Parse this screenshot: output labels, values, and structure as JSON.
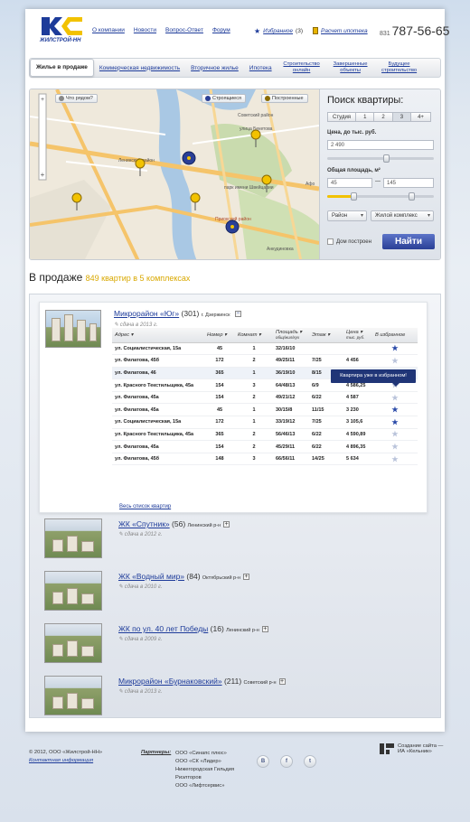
{
  "header": {
    "logo_text": "ЖИЛСТРОЙ-НН",
    "nav": [
      "О компании",
      "Новости",
      "Вопрос-Ответ",
      "Форум"
    ],
    "favorites_label": "Избранное",
    "favorites_count": "(3)",
    "mortgage_label": "Расчет ипотека",
    "phone_code": "831",
    "phone_number": "787-56-65"
  },
  "menu": [
    "Жилье в продаже",
    "Коммерческая недвижимость",
    "Вторичное жилье",
    "Ипотека",
    "Строительство онлайн",
    "Завершенные объекты",
    "Будущее строительство"
  ],
  "map": {
    "btn_where": "Что рядом?",
    "btn_building": "Строящиеся",
    "btn_built": "Построенные",
    "labels": [
      "Ленинский район",
      "Советский район",
      "Приокский район",
      "улица Бекетова",
      "парк имени Швейцарии",
      "Анкудиновка",
      "Афо"
    ]
  },
  "search": {
    "title": "Поиск квартиры:",
    "rooms": [
      "Студия",
      "1",
      "2",
      "3",
      "4+"
    ],
    "price_label": "Цена, до тыс. руб.",
    "price_value": "2 490",
    "area_label": "Общая площадь, м²",
    "area_from": "45",
    "area_to": "145",
    "district": "Район",
    "complex": "Жилой комплекс",
    "built_label": "Дом построен",
    "find": "Найти"
  },
  "listing": {
    "title": "В продаже",
    "subtitle": "849 квартир в 5 комплексах"
  },
  "main_complex": {
    "name": "Микрорайон «Юг»",
    "count": "(301)",
    "district": "г. Дзержинск",
    "due": "сдача в 2013 г.",
    "columns": [
      "Адрес",
      "Номер",
      "Комнат",
      "Площадь",
      "Этаж",
      "Цена",
      "В избранное"
    ],
    "area_sub": "общ/жил/кух",
    "price_sub": "тыс. руб.",
    "rows": [
      {
        "addr": "ул. Социалистическая, 15а",
        "num": "45",
        "rooms": "1",
        "area": "32/16/10",
        "floor": "",
        "price": "",
        "fav": true
      },
      {
        "addr": "ул. Филатова, 45б",
        "num": "172",
        "rooms": "2",
        "area": "49/25/11",
        "floor": "7/25",
        "price": "4 456",
        "fav": false
      },
      {
        "addr": "ул. Филатова, 46",
        "num": "365",
        "rooms": "1",
        "area": "36/19/10",
        "floor": "8/15",
        "price": "3 989,5",
        "fav": false
      },
      {
        "addr": "ул. Красного Текстильщика, 45а",
        "num": "154",
        "rooms": "3",
        "area": "64/48/13",
        "floor": "6/9",
        "price": "4 586,25",
        "fav": false
      },
      {
        "addr": "ул. Филатова, 45а",
        "num": "154",
        "rooms": "2",
        "area": "49/21/12",
        "floor": "6/22",
        "price": "4 587",
        "fav": false
      },
      {
        "addr": "ул. Филатова, 45а",
        "num": "45",
        "rooms": "1",
        "area": "30/15/8",
        "floor": "11/15",
        "price": "3 230",
        "fav": true
      },
      {
        "addr": "ул. Социалистическая, 15а",
        "num": "172",
        "rooms": "1",
        "area": "33/19/12",
        "floor": "7/25",
        "price": "3 105,6",
        "fav": true
      },
      {
        "addr": "ул. Красного Текстильщика, 45а",
        "num": "365",
        "rooms": "2",
        "area": "56/46/13",
        "floor": "6/22",
        "price": "4 590,89",
        "fav": false
      },
      {
        "addr": "ул. Филатова, 45а",
        "num": "154",
        "rooms": "2",
        "area": "45/29/11",
        "floor": "6/22",
        "price": "4 896,35",
        "fav": false
      },
      {
        "addr": "ул. Филатова, 45б",
        "num": "148",
        "rooms": "3",
        "area": "66/56/11",
        "floor": "14/25",
        "price": "5 634",
        "fav": false
      }
    ],
    "tooltip": "Квартира уже в избранном!",
    "all_link": "Весь список квартир"
  },
  "complexes": [
    {
      "name": "ЖК «Спутник»",
      "count": "(56)",
      "district": "Ленинский р-н",
      "due": "сдача в 2012 г."
    },
    {
      "name": "ЖК «Водный мир»",
      "count": "(84)",
      "district": "Октябрьский р-н",
      "due": "сдача в 2010 г."
    },
    {
      "name": "ЖК по ул. 40 лет Победы",
      "count": "(16)",
      "district": "Ленинский р-н",
      "due": "сдача в 2009 г."
    },
    {
      "name": "Микрорайон «Бурнаковский»",
      "count": "(211)",
      "district": "Советский р-н",
      "due": "сдача в 2013 г."
    }
  ],
  "footer": {
    "copyright": "© 2012, ООО «Жилстрой-НН»",
    "contacts": "Контактная информация",
    "partners_label": "Партнеры:",
    "partners": [
      "ООО «Синапс плюс»",
      "ООО «СК «Лидер»",
      "Нижегородская Гильдия Риэлторов",
      "ООО «Лифтсервис»"
    ],
    "social": [
      "B",
      "f",
      "t"
    ],
    "credit_1": "Создание сайта —",
    "credit_2": "ИА «Кельник»"
  },
  "colors": {
    "brand": "#1d3b9a",
    "accent": "#f2c200",
    "button": "#2a3f96"
  }
}
